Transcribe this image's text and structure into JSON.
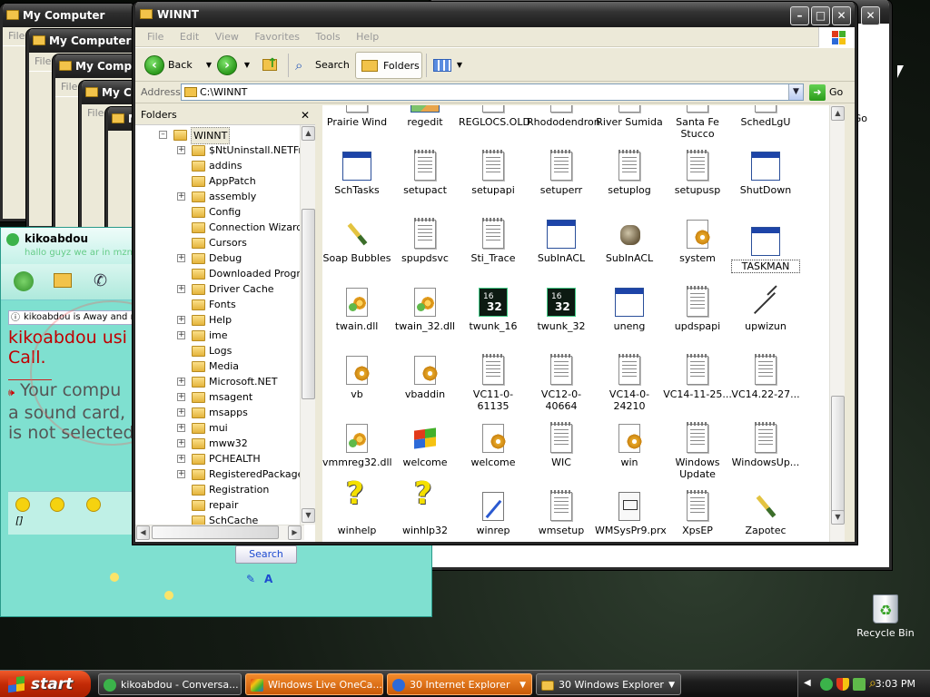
{
  "bg_windows": [
    {
      "title": "My Computer",
      "menu": "File",
      "tool": "Add",
      "fold": "Fold"
    },
    {
      "title": "My Computer",
      "menu": "File",
      "tool": "Add",
      "fold": "Fold"
    },
    {
      "title": "My Computer",
      "menu": "File",
      "tool": "Add",
      "fold": "Fold"
    },
    {
      "title": "My Computer",
      "menu": "File",
      "tool": "Add",
      "fold": "Fold"
    },
    {
      "title": "My Computer",
      "menu": "File",
      "tool": "Add",
      "fold": "Fold"
    }
  ],
  "back_window": {
    "go_label": "Go"
  },
  "main": {
    "title": "WINNT",
    "menu": [
      "File",
      "Edit",
      "View",
      "Favorites",
      "Tools",
      "Help"
    ],
    "toolbar": {
      "back": "Back",
      "search": "Search",
      "folders": "Folders"
    },
    "address": {
      "label": "Address",
      "value": "C:\\WINNT",
      "go": "Go"
    },
    "folders_pane": {
      "title": "Folders",
      "close": "✕",
      "root": "WINNT",
      "items": [
        {
          "label": "$NtUninstall.NETFram",
          "expandable": true
        },
        {
          "label": "addins",
          "expandable": false
        },
        {
          "label": "AppPatch",
          "expandable": false
        },
        {
          "label": "assembly",
          "expandable": true
        },
        {
          "label": "Config",
          "expandable": false
        },
        {
          "label": "Connection Wizard",
          "expandable": false
        },
        {
          "label": "Cursors",
          "expandable": false
        },
        {
          "label": "Debug",
          "expandable": true
        },
        {
          "label": "Downloaded Program",
          "expandable": false
        },
        {
          "label": "Driver Cache",
          "expandable": true
        },
        {
          "label": "Fonts",
          "expandable": false
        },
        {
          "label": "Help",
          "expandable": true
        },
        {
          "label": "ime",
          "expandable": true
        },
        {
          "label": "Logs",
          "expandable": false
        },
        {
          "label": "Media",
          "expandable": false
        },
        {
          "label": "Microsoft.NET",
          "expandable": true
        },
        {
          "label": "msagent",
          "expandable": true
        },
        {
          "label": "msapps",
          "expandable": true
        },
        {
          "label": "mui",
          "expandable": true
        },
        {
          "label": "mww32",
          "expandable": true
        },
        {
          "label": "PCHEALTH",
          "expandable": true
        },
        {
          "label": "RegisteredPackages",
          "expandable": true
        },
        {
          "label": "Registration",
          "expandable": false
        },
        {
          "label": "repair",
          "expandable": false
        },
        {
          "label": "SchCache",
          "expandable": false
        }
      ]
    },
    "files": [
      [
        {
          "label": "Prairie Wind",
          "icon": "image-icon"
        },
        {
          "label": "regedit",
          "icon": "registry-editor-icon"
        },
        {
          "label": "REGLOCS.OLD",
          "icon": "text-file-icon"
        },
        {
          "label": "Rhododendron",
          "icon": "image-icon"
        },
        {
          "label": "River Sumida",
          "icon": "image-icon"
        },
        {
          "label": "Santa Fe Stucco",
          "icon": "image-icon"
        },
        {
          "label": "SchedLgU",
          "icon": "text-file-icon"
        }
      ],
      [
        {
          "label": "SchTasks",
          "icon": "application-icon"
        },
        {
          "label": "setupact",
          "icon": "text-file-icon"
        },
        {
          "label": "setupapi",
          "icon": "text-file-icon"
        },
        {
          "label": "setuperr",
          "icon": "text-file-icon"
        },
        {
          "label": "setuplog",
          "icon": "text-file-icon"
        },
        {
          "label": "setupusp",
          "icon": "text-file-icon"
        },
        {
          "label": "ShutDown",
          "icon": "application-icon"
        }
      ],
      [
        {
          "label": "Soap Bubbles",
          "icon": "paintbrush-icon"
        },
        {
          "label": "spupdsvc",
          "icon": "text-file-icon"
        },
        {
          "label": "Sti_Trace",
          "icon": "text-file-icon"
        },
        {
          "label": "SubInACL",
          "icon": "application-icon"
        },
        {
          "label": "SubInACL",
          "icon": "animal-icon"
        },
        {
          "label": "system",
          "icon": "config-file-icon"
        },
        {
          "label": "TASKMAN",
          "icon": "application-icon"
        }
      ],
      [
        {
          "label": "twain.dll",
          "icon": "dll-icon"
        },
        {
          "label": "twain_32.dll",
          "icon": "dll-icon"
        },
        {
          "label": "twunk_16",
          "icon": "dos-icon"
        },
        {
          "label": "twunk_32",
          "icon": "dos-icon"
        },
        {
          "label": "uneng",
          "icon": "application-icon"
        },
        {
          "label": "updspapi",
          "icon": "text-file-icon"
        },
        {
          "label": "upwizun",
          "icon": "pickaxe-icon"
        }
      ],
      [
        {
          "label": "vb",
          "icon": "config-file-icon"
        },
        {
          "label": "vbaddin",
          "icon": "config-file-icon"
        },
        {
          "label": "VC11-0-61135",
          "icon": "text-file-icon"
        },
        {
          "label": "VC12-0-40664",
          "icon": "text-file-icon"
        },
        {
          "label": "VC14-0-24210",
          "icon": "text-file-icon"
        },
        {
          "label": "VC14-11-25...",
          "icon": "text-file-icon"
        },
        {
          "label": "VC14.22-27...",
          "icon": "text-file-icon"
        }
      ],
      [
        {
          "label": "vmmreg32.dll",
          "icon": "dll-icon"
        },
        {
          "label": "welcome",
          "icon": "windows-flag-icon"
        },
        {
          "label": "welcome",
          "icon": "config-file-icon"
        },
        {
          "label": "WIC",
          "icon": "text-file-icon"
        },
        {
          "label": "win",
          "icon": "config-file-icon"
        },
        {
          "label": "Windows Update",
          "icon": "text-file-icon"
        },
        {
          "label": "WindowsUp...",
          "icon": "text-file-icon"
        }
      ],
      [
        {
          "label": "winhelp",
          "icon": "help-icon"
        },
        {
          "label": "winhlp32",
          "icon": "help-icon"
        },
        {
          "label": "winrep",
          "icon": "scroll-icon"
        },
        {
          "label": "wmsetup",
          "icon": "text-file-icon"
        },
        {
          "label": "WMSysPr9.prx",
          "icon": "system-file-icon"
        },
        {
          "label": "XpsEP",
          "icon": "text-file-icon"
        },
        {
          "label": "Zapotec",
          "icon": "paintbrush-icon"
        }
      ]
    ]
  },
  "messenger": {
    "name": "kikoabdou",
    "status": "hallo guyz we ar in mzn p",
    "away_notice": "kikoabdou is Away and m",
    "chat_line1": "kikoabdou usi",
    "chat_line2": "Call.",
    "chat_line3": "Your compu",
    "chat_line4": "a sound card,",
    "chat_line5": "is not selected",
    "input_text": "[]",
    "search": "Search"
  },
  "desktop": {
    "recycle_bin": "Recycle Bin"
  },
  "taskbar": {
    "start": "start",
    "tasks": [
      {
        "label": "kikoabdou - Conversa...",
        "style": "dark"
      },
      {
        "label": "Windows Live OneCa...",
        "style": "orange"
      },
      {
        "label": "30 Internet Explorer",
        "style": "orange"
      },
      {
        "label": "30 Windows Explorer",
        "style": "dark"
      }
    ],
    "clock": "3:03 PM"
  }
}
